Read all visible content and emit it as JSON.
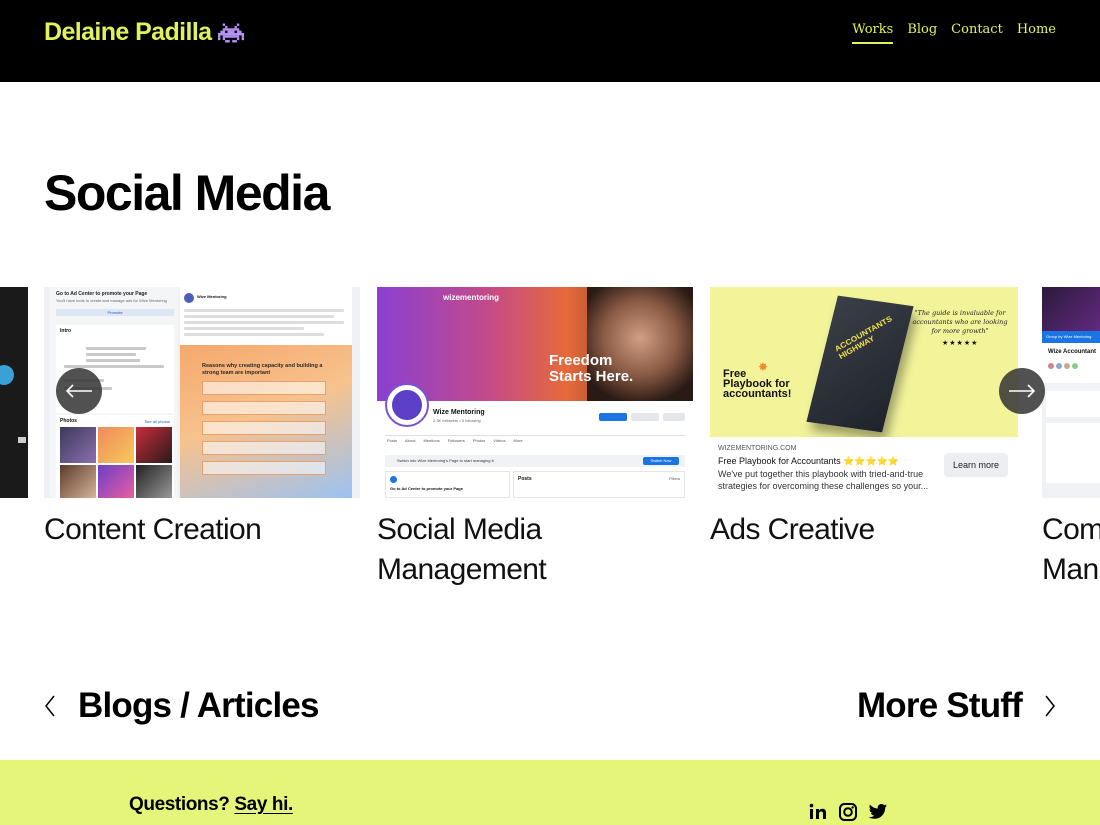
{
  "header": {
    "brand": "Delaine Padilla",
    "brand_icon": "space-invader-icon",
    "nav": [
      {
        "label": "Works",
        "active": true
      },
      {
        "label": "Blog",
        "active": false
      },
      {
        "label": "Contact",
        "active": false
      },
      {
        "label": "Home",
        "active": false
      }
    ]
  },
  "page_title": "Social Media",
  "carousel": {
    "slides": [
      {
        "caption": "Content Creation",
        "thumb": {
          "ad_center": "Go to Ad Center to promote your Page",
          "ad_center_sub": "You'll have tools to create and manage ads for Wize Mentoring",
          "promote": "Promote",
          "intro": "Intro",
          "photos": "Photos",
          "see_all": "See all photos",
          "post_title": "Wize Mentoring",
          "reasons": "Reasons why creating capacity and building a strong team are important"
        }
      },
      {
        "caption": "Social Media Management",
        "caption_lines": [
          "Social Media",
          "Management"
        ],
        "thumb": {
          "brand": "wizementoring",
          "headline_1": "Freedom",
          "headline_2": "Starts Here.",
          "page_name": "Wize Mentoring",
          "followers": "2.3K followers • 3 following",
          "tabs": [
            "Posts",
            "About",
            "Mentions",
            "Followers",
            "Photos",
            "Videos",
            "More"
          ],
          "switch": "Switch into Wize Mentoring's Page to start managing it.",
          "switch_btn": "Switch Now",
          "ad_center": "Go to Ad Center to promote your Page",
          "posts": "Posts",
          "filters": "Filters"
        }
      },
      {
        "caption": "Ads Creative",
        "thumb": {
          "quote": "\"The guide is invaluable for accountants who are looking for more growth\"",
          "stars": "★★★★★",
          "free_line_1": "Free",
          "free_line_2": "Playbook for",
          "free_line_3": "accountants!",
          "book_title": "ACCOUNTANTS HIGHWAY",
          "domain": "WIZEMENTORING.COM",
          "headline": "Free Playbook for Accountants ⭐⭐⭐⭐⭐",
          "desc": "We've put together this playbook with tried-and-true strategies for overcoming these challenges so your...",
          "cta": "Learn more"
        }
      },
      {
        "caption": "Community Management",
        "caption_lines": [
          "Com",
          "Man"
        ],
        "thumb": {
          "group": "Group by Wize Mentoring",
          "title": "Wize Accountant"
        }
      }
    ],
    "prev_icon": "arrow-left-icon",
    "next_icon": "arrow-right-icon"
  },
  "pager": {
    "prev_label": "Blogs / Articles",
    "next_label": "More Stuff"
  },
  "footer": {
    "questions": "Questions?",
    "say_hi": "Say hi.",
    "social": [
      "linkedin-icon",
      "instagram-icon",
      "twitter-icon"
    ]
  },
  "colors": {
    "accent": "#e3f25a",
    "footer_bg": "#e5f57a",
    "header_bg": "#000000"
  }
}
